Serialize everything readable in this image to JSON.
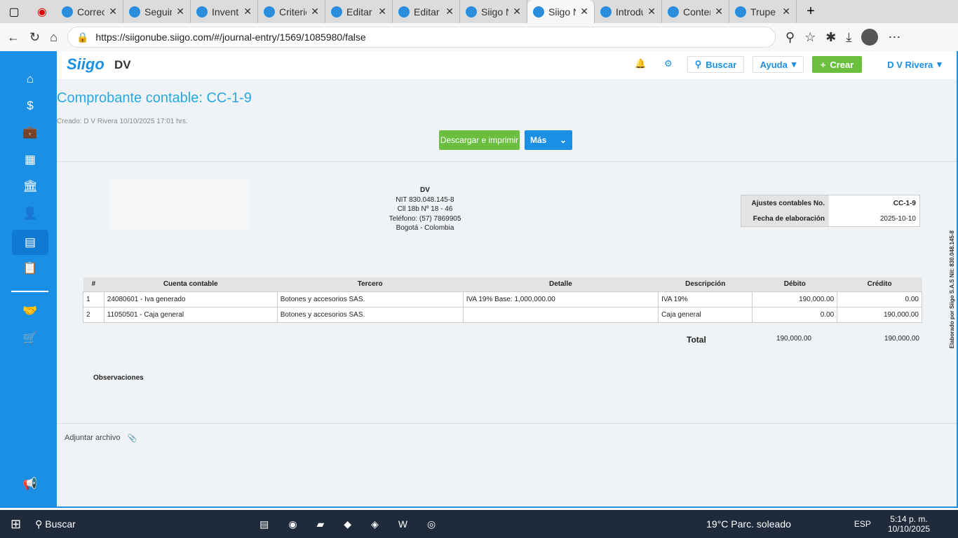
{
  "browser": {
    "tabs": [
      "Correo",
      "Seguimiento",
      "Inventario",
      "Criterios",
      "Editar",
      "Editar",
      "Siigo N",
      "Siigo N",
      "Introducción",
      "Contenido",
      "Trupe"
    ],
    "active_tab": 7,
    "url": "https://siigonube.siigo.com/#/journal-entry/1569/1085980/false"
  },
  "app": {
    "logo": "Siigo",
    "company": "DV",
    "search": "Buscar",
    "help": "Ayuda",
    "create": "Crear",
    "user": "D V Rivera",
    "accent": "#1a8fe3",
    "green": "#6abf3f"
  },
  "sidebar": {
    "items": [
      "home-icon",
      "money-icon",
      "briefcase-icon",
      "inventory-icon",
      "bank-icon",
      "user-icon",
      "document-icon",
      "clipboard-icon",
      "handshake-icon",
      "cart-icon",
      "megaphone-icon"
    ],
    "active": 6
  },
  "page": {
    "title": "Comprobante contable: CC-1-9",
    "created": "Creado: D V Rivera 10/10/2025 17:01 hrs.",
    "download": "Descargar e imprimir",
    "more": "Más"
  },
  "doc": {
    "company": "DV",
    "nit": "NIT 830.048.145-8",
    "address": "Cll 18b Nº 18 - 46",
    "phone": "Teléfono: (57) 7869905",
    "city": "Bogotá - Colombia",
    "info": [
      {
        "k": "Ajustes contables No.",
        "v": "CC-1-9"
      },
      {
        "k": "Fecha de elaboración",
        "v": "2025-10-10"
      }
    ],
    "columns": [
      "#",
      "Cuenta contable",
      "Tercero",
      "Detalle",
      "Descripción",
      "Débito",
      "Crédito"
    ],
    "rows": [
      [
        "1",
        "24080601 - Iva generado",
        "Botones y accesorios SAS.",
        "IVA 19% Base: 1,000,000.00",
        "IVA 19%",
        "190,000.00",
        "0.00"
      ],
      [
        "2",
        "11050501 - Caja general",
        "Botones y accesorios SAS.",
        "",
        "Caja general",
        "0.00",
        "190,000.00"
      ]
    ],
    "total_label": "Total",
    "total_debit": "190,000.00",
    "total_credit": "190,000.00",
    "observations": "Observaciones",
    "vertical": "Elaborado por Siigo S.A.S Nit: 830.048.145-8"
  },
  "attach": "Adjuntar archivo",
  "taskbar": {
    "search": "Buscar",
    "weather": "19°C  Parc. soleado",
    "lang": "ESP",
    "time": "5:14 p. m.",
    "date": "10/10/2025"
  }
}
